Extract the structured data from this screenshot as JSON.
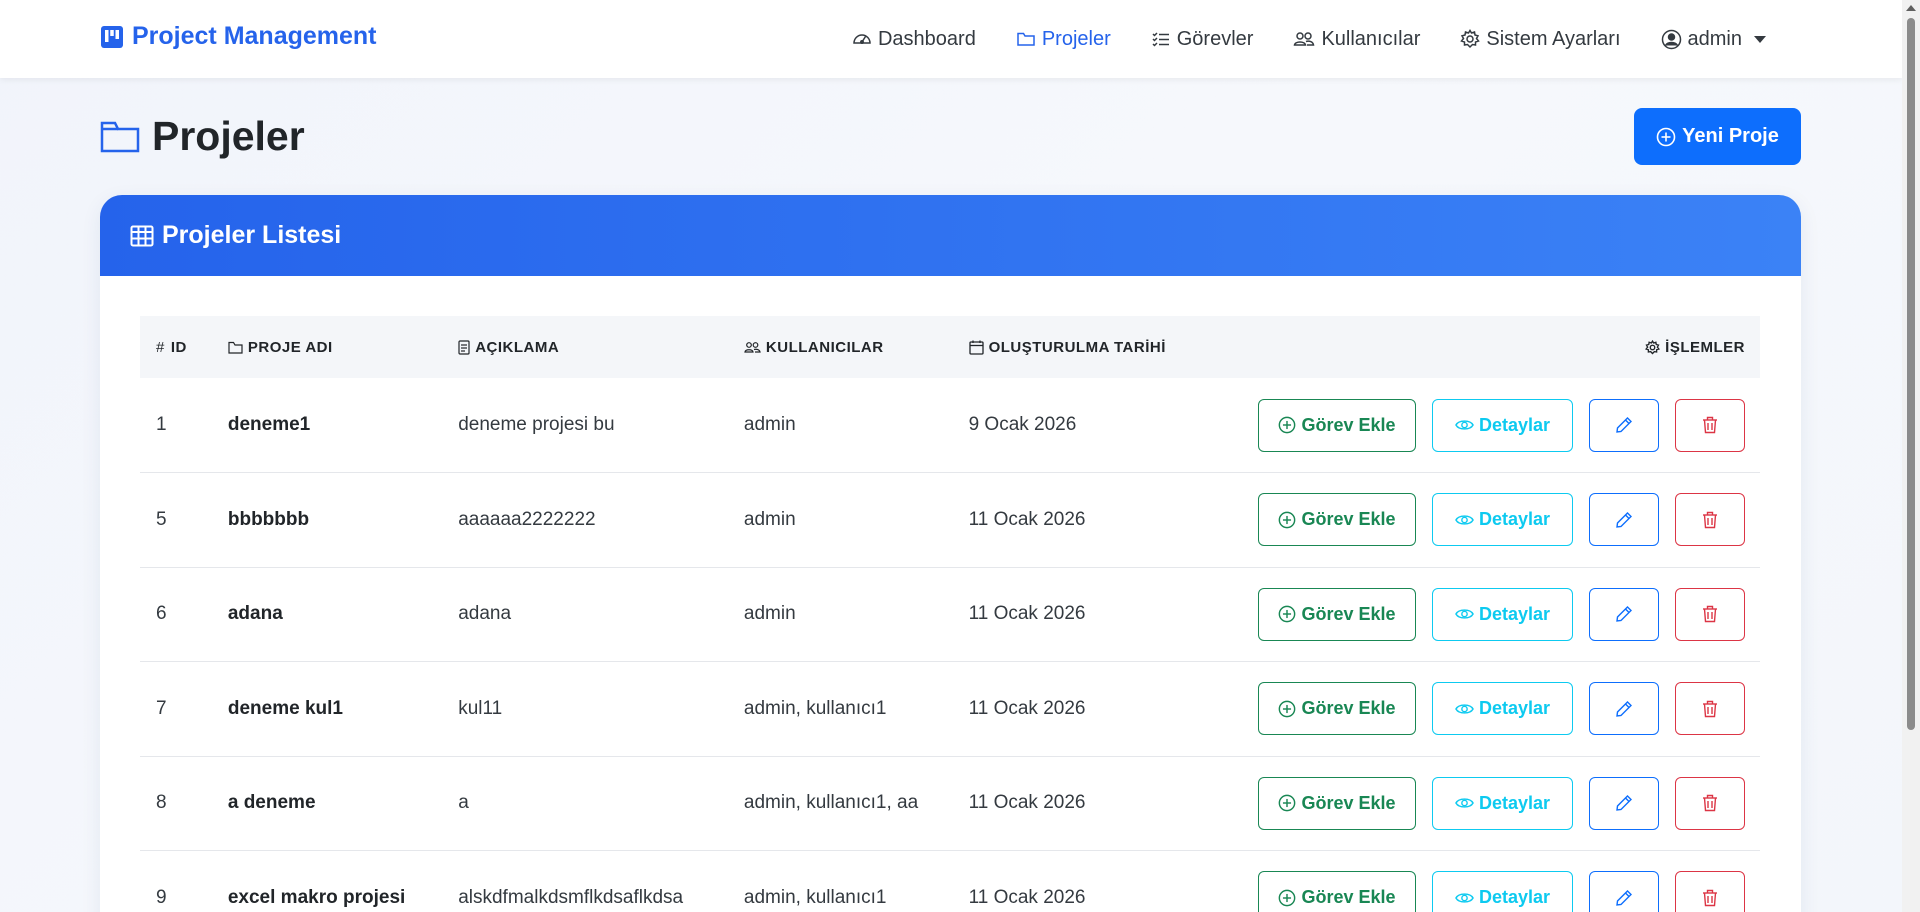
{
  "navbar": {
    "brand": "Project Management",
    "links": [
      {
        "label": "Dashboard",
        "icon": "speedometer-icon",
        "active": false
      },
      {
        "label": "Projeler",
        "icon": "folder-icon",
        "active": true
      },
      {
        "label": "Görevler",
        "icon": "list-check-icon",
        "active": false
      },
      {
        "label": "Kullanıcılar",
        "icon": "people-icon",
        "active": false
      },
      {
        "label": "Sistem Ayarları",
        "icon": "gear-icon",
        "active": false
      }
    ],
    "user": "admin"
  },
  "page": {
    "title": "Projeler",
    "new_button": "Yeni Proje"
  },
  "card": {
    "title": "Projeler Listesi"
  },
  "table": {
    "headers": {
      "id": "ID",
      "name": "PROJE ADI",
      "desc": "AÇIKLAMA",
      "users": "KULLANICILAR",
      "date": "OLUŞTURULMA TARİHİ",
      "ops": "İŞLEMLER"
    },
    "action_labels": {
      "add_task": "Görev Ekle",
      "details": "Detaylar"
    },
    "rows": [
      {
        "id": "1",
        "name": "deneme1",
        "desc": "deneme projesi bu",
        "users": "admin",
        "date": "9 Ocak 2026"
      },
      {
        "id": "5",
        "name": "bbbbbbb",
        "desc": "aaaaaa2222222",
        "users": "admin",
        "date": "11 Ocak 2026"
      },
      {
        "id": "6",
        "name": "adana",
        "desc": "adana",
        "users": "admin",
        "date": "11 Ocak 2026"
      },
      {
        "id": "7",
        "name": "deneme kul1",
        "desc": "kul11",
        "users": "admin, kullanıcı1",
        "date": "11 Ocak 2026"
      },
      {
        "id": "8",
        "name": "a deneme",
        "desc": "a",
        "users": "admin, kullanıcı1, aa",
        "date": "11 Ocak 2026"
      },
      {
        "id": "9",
        "name": "excel makro projesi",
        "desc": "alskdfmalkdsmflkdsaflkdsa",
        "users": "admin, kullanıcı1",
        "date": "11 Ocak 2026"
      }
    ]
  },
  "colors": {
    "primary": "#0d6efd",
    "brand": "#2563eb",
    "success": "#198754",
    "info": "#0dcaf0",
    "danger": "#dc3545"
  }
}
